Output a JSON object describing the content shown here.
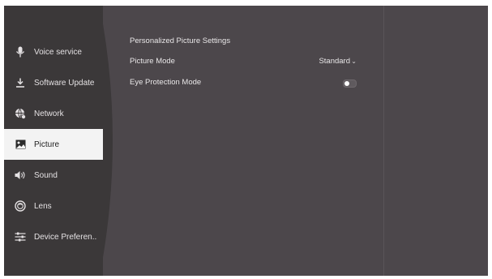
{
  "sidebar": {
    "items": [
      {
        "label": "Voice service",
        "icon": "microphone-icon"
      },
      {
        "label": "Software Update",
        "icon": "download-icon"
      },
      {
        "label": "Network",
        "icon": "network-globe-icon"
      },
      {
        "label": "Picture",
        "icon": "picture-icon",
        "active": true
      },
      {
        "label": "Sound",
        "icon": "speaker-icon"
      },
      {
        "label": "Lens",
        "icon": "lens-icon"
      },
      {
        "label": "Device Preferen..",
        "icon": "sliders-icon"
      }
    ]
  },
  "content": {
    "section_title": "Personalized Picture Settings",
    "picture_mode": {
      "label": "Picture Mode",
      "value": "Standard",
      "icon": "chevron-down-icon"
    },
    "eye_protection": {
      "label": "Eye Protection Mode",
      "enabled": false
    }
  },
  "colors": {
    "background": "#4c474b",
    "sidebar": "#3b3839",
    "active_item": "#f3f3f3"
  }
}
